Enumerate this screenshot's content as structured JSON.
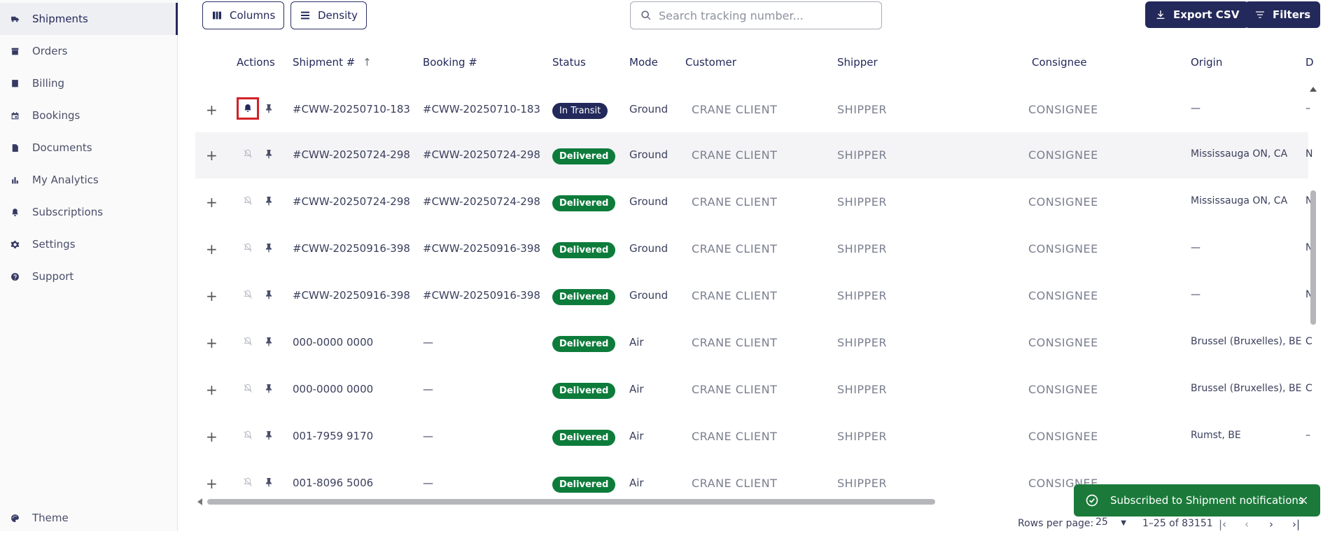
{
  "sidebar": {
    "items": [
      {
        "label": "Shipments",
        "icon": "truck-icon",
        "active": true
      },
      {
        "label": "Orders",
        "icon": "archive-icon"
      },
      {
        "label": "Billing",
        "icon": "receipt-icon"
      },
      {
        "label": "Bookings",
        "icon": "calendar-icon"
      },
      {
        "label": "Documents",
        "icon": "document-icon"
      },
      {
        "label": "My Analytics",
        "icon": "bar-chart-icon"
      },
      {
        "label": "Subscriptions",
        "icon": "bell-icon"
      },
      {
        "label": "Settings",
        "icon": "gear-icon"
      },
      {
        "label": "Support",
        "icon": "help-icon"
      }
    ],
    "theme_label": "Theme"
  },
  "toolbar": {
    "columns_label": "Columns",
    "density_label": "Density",
    "search_placeholder": "Search tracking number...",
    "export_label": "Export CSV",
    "filters_label": "Filters"
  },
  "table": {
    "headers": {
      "actions": "Actions",
      "shipment": "Shipment #",
      "booking": "Booking #",
      "status": "Status",
      "mode": "Mode",
      "customer": "Customer",
      "shipper": "Shipper",
      "consignee": "Consignee",
      "origin": "Origin",
      "destination": "Des"
    },
    "rows": [
      {
        "shipment": "#CWW-20250710-183",
        "booking": "#CWW-20250710-183",
        "status": "In Transit",
        "mode": "Ground",
        "customer": "CRANE CLIENT",
        "shipper": "SHIPPER",
        "consignee": "CONSIGNEE",
        "origin": "—",
        "dest": "–",
        "subscribed": true
      },
      {
        "shipment": "#CWW-20250724-298",
        "booking": "#CWW-20250724-298",
        "status": "Delivered",
        "mode": "Ground",
        "customer": "CRANE CLIENT",
        "shipper": "SHIPPER",
        "consignee": "CONSIGNEE",
        "origin": "Mississauga ON, CA",
        "dest": "N"
      },
      {
        "shipment": "#CWW-20250724-298",
        "booking": "#CWW-20250724-298",
        "status": "Delivered",
        "mode": "Ground",
        "customer": "CRANE CLIENT",
        "shipper": "SHIPPER",
        "consignee": "CONSIGNEE",
        "origin": "Mississauga ON, CA",
        "dest": "N"
      },
      {
        "shipment": "#CWW-20250916-398",
        "booking": "#CWW-20250916-398",
        "status": "Delivered",
        "mode": "Ground",
        "customer": "CRANE CLIENT",
        "shipper": "SHIPPER",
        "consignee": "CONSIGNEE",
        "origin": "—",
        "dest": "N"
      },
      {
        "shipment": "#CWW-20250916-398",
        "booking": "#CWW-20250916-398",
        "status": "Delivered",
        "mode": "Ground",
        "customer": "CRANE CLIENT",
        "shipper": "SHIPPER",
        "consignee": "CONSIGNEE",
        "origin": "—",
        "dest": "N"
      },
      {
        "shipment": "000-0000 0000",
        "booking": "—",
        "status": "Delivered",
        "mode": "Air",
        "customer": "CRANE CLIENT",
        "shipper": "SHIPPER",
        "consignee": "CONSIGNEE",
        "origin": "Brussel (Bruxelles), BE",
        "dest": "C"
      },
      {
        "shipment": "000-0000 0000",
        "booking": "—",
        "status": "Delivered",
        "mode": "Air",
        "customer": "CRANE CLIENT",
        "shipper": "SHIPPER",
        "consignee": "CONSIGNEE",
        "origin": "Brussel (Bruxelles), BE",
        "dest": "C"
      },
      {
        "shipment": "001-7959 9170",
        "booking": "—",
        "status": "Delivered",
        "mode": "Air",
        "customer": "CRANE CLIENT",
        "shipper": "SHIPPER",
        "consignee": "CONSIGNEE",
        "origin": "Rumst, BE",
        "dest": "–"
      },
      {
        "shipment": "001-8096 5006",
        "booking": "—",
        "status": "Delivered",
        "mode": "Air",
        "customer": "CRANE CLIENT",
        "shipper": "SHIPPER",
        "consignee": "CONSIGNEE",
        "origin": "",
        "dest": ""
      }
    ]
  },
  "footer": {
    "rows_per_page_label": "Rows per page:",
    "rows_per_page_value": "25",
    "range": "1–25 of 83151"
  },
  "toast": {
    "message": "Subscribed to Shipment notifications"
  },
  "colors": {
    "primary": "#23295a",
    "delivered": "#0d7c3b",
    "toast": "#1b7a3a",
    "highlight": "#d32027"
  }
}
